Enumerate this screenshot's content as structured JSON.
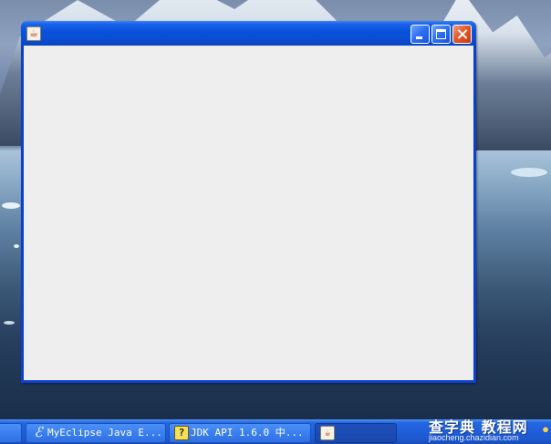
{
  "desktop": {
    "colors": {
      "window_frame": "#0a3fd0",
      "title_bar": "#0a52db",
      "client_area": "#eeeeee",
      "close_button": "#e45a2a",
      "taskbar": "#1f5ed8"
    }
  },
  "window": {
    "title": "",
    "icon": "java-cup-icon",
    "controls": {
      "minimize": "minimize-icon",
      "maximize": "maximize-icon",
      "close": "close-icon"
    }
  },
  "taskbar": {
    "buttons": [
      {
        "label": "MyEclipse Java E...",
        "icon": "eclipse-icon",
        "glyph": "ℰ"
      },
      {
        "label": "JDK API 1.6.0 中...",
        "icon": "help-file-icon",
        "glyph": "?"
      },
      {
        "label": "",
        "icon": "java-cup-icon",
        "glyph": "☕"
      }
    ]
  },
  "watermark": {
    "title": "查字典 教程网",
    "url": "jiaocheng.chazidian.com"
  }
}
